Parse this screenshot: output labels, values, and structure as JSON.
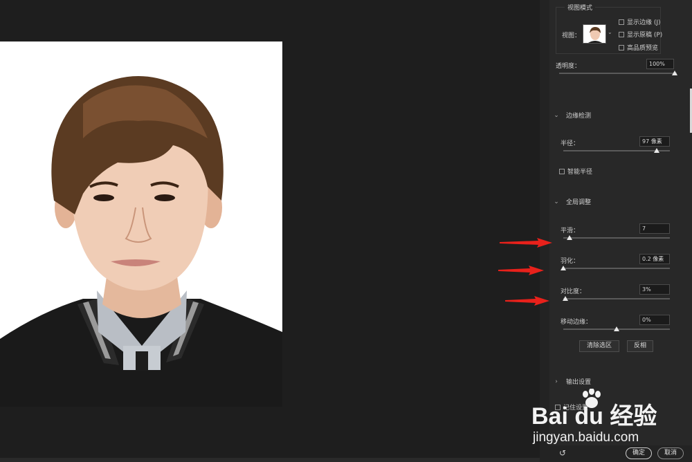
{
  "view_mode": {
    "title": "视图模式",
    "view_label": "视图：",
    "show_edge": "显示边缘 (J)",
    "show_original": "显示原稿 (P)",
    "high_quality": "高品质预览"
  },
  "opacity": {
    "label": "透明度：",
    "value": "100%",
    "level_percent": 100
  },
  "edge_detection": {
    "title": "边缘检测",
    "radius_label": "半径：",
    "radius_value": "97 像素",
    "smart_radius": "智能半径"
  },
  "global_refine": {
    "title": "全局调整",
    "smooth_label": "平滑：",
    "smooth_value": "7",
    "feather_label": "羽化：",
    "feather_value": "0.2 像素",
    "contrast_label": "对比度：",
    "contrast_value": "3%",
    "shift_label": "移动边缘：",
    "shift_value": "0%",
    "clear_selection": "清除选区",
    "invert": "反相"
  },
  "output": {
    "title": "输出设置",
    "remember": "记住设置"
  },
  "footer": {
    "ok": "确定",
    "cancel": "取消"
  },
  "watermark": {
    "brand": "Bai du 经验",
    "url": "jingyan.baidu.com"
  },
  "colors": {
    "arrow": "#e8211b",
    "panel": "#282828",
    "canvas": "#1e1e1e"
  }
}
